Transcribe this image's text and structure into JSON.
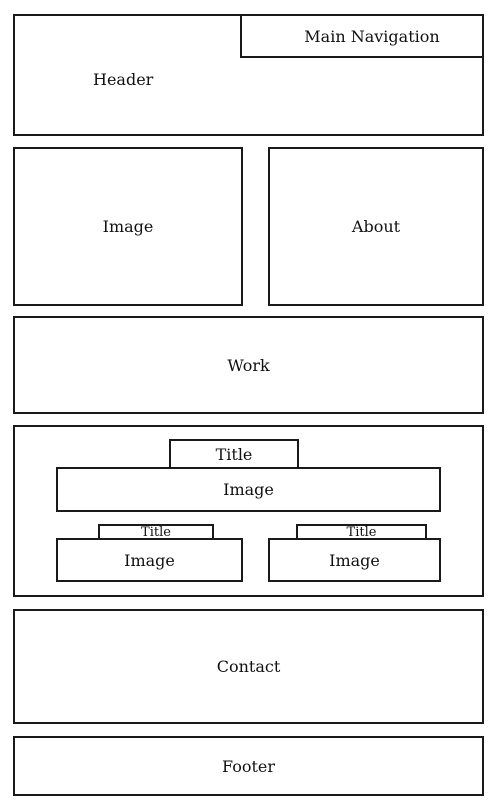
{
  "header": {
    "label": "Header",
    "nav_label": "Main Navigation"
  },
  "image_block": {
    "label": "Image"
  },
  "about_block": {
    "label": "About"
  },
  "work_block": {
    "label": "Work"
  },
  "portfolio": {
    "title_main": "Title",
    "image_main": "Image",
    "items": [
      {
        "title": "Title",
        "image": "Image"
      },
      {
        "title": "Title",
        "image": "Image"
      }
    ]
  },
  "contact_block": {
    "label": "Contact"
  },
  "footer": {
    "label": "Footer"
  }
}
